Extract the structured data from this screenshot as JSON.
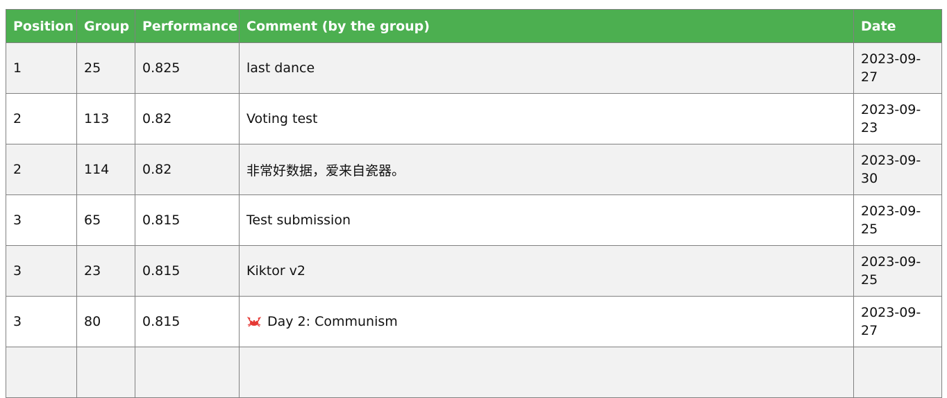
{
  "headers": [
    "Position",
    "Group",
    "Performance",
    "Comment (by the group)",
    "Date"
  ],
  "rows": [
    {
      "position": "1",
      "group": "25",
      "performance": "0.825",
      "comment": "last dance",
      "date_line1": "2023-09-",
      "date_line2": "27"
    },
    {
      "position": "2",
      "group": "113",
      "performance": "0.82",
      "comment": "Voting test",
      "date_line1": "2023-09-",
      "date_line2": "23"
    },
    {
      "position": "2",
      "group": "114",
      "performance": "0.82",
      "comment": "非常好数据，爱来自瓷器。",
      "date_line1": "2023-09-",
      "date_line2": "30"
    },
    {
      "position": "3",
      "group": "65",
      "performance": "0.815",
      "comment": "Test submission",
      "date_line1": "2023-09-",
      "date_line2": "25"
    },
    {
      "position": "3",
      "group": "23",
      "performance": "0.815",
      "comment": "Kiktor v2",
      "date_line1": "2023-09-",
      "date_line2": "25"
    },
    {
      "position": "3",
      "group": "80",
      "performance": "0.815",
      "comment": "Day 2: Communism",
      "comment_icon": "crab-icon",
      "date_line1": "2023-09-",
      "date_line2": "27"
    }
  ],
  "colors": {
    "header_bg": "#4caf50",
    "header_text": "#ffffff",
    "row_alt_bg": "#f2f2f2",
    "border": "#808080"
  }
}
